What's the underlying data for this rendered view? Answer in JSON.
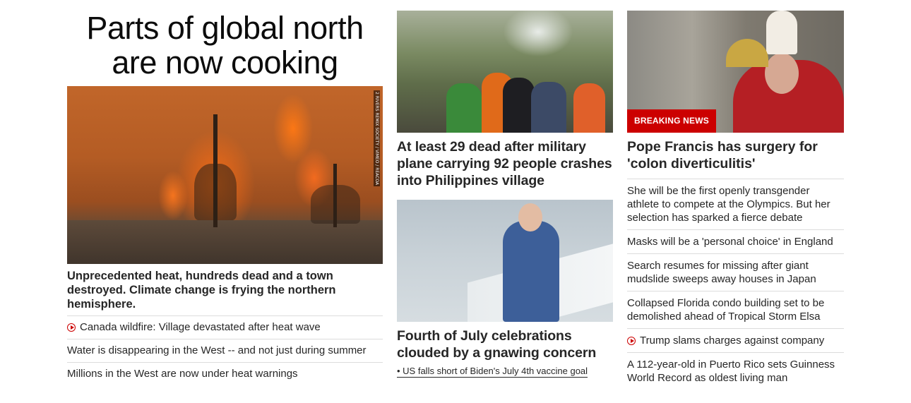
{
  "left": {
    "headline": "Parts of global north are now cooking",
    "image_credit": "2 RIVERS REMIX SOCIETY / VIMEO / REACOA",
    "lead": "Unprecedented heat, hundreds dead and a town destroyed. Climate change is frying the northern hemisphere.",
    "items": [
      {
        "text": "Canada wildfire: Village devastated after heat wave",
        "video": true
      },
      {
        "text": "Water is disappearing in the West -- and not just during summer",
        "video": false
      },
      {
        "text": "Millions in the West are now under heat warnings",
        "video": false
      }
    ]
  },
  "middle": {
    "story1_title": "At least 29 dead after military plane carrying 92 people crashes into Philippines village",
    "story2_title": "Fourth of July celebrations clouded by a gnawing concern",
    "story2_bullet": "• US falls short of Biden's July 4th vaccine goal"
  },
  "right": {
    "badge": "BREAKING NEWS",
    "title": "Pope Francis has surgery for 'colon diverticulitis'",
    "items": [
      {
        "text": "She will be the first openly transgender athlete to compete at the Olympics. But her selection has sparked a fierce debate",
        "video": false
      },
      {
        "text": "Masks will be a 'personal choice' in England",
        "video": false
      },
      {
        "text": "Search resumes for missing after giant mudslide sweeps away houses in Japan",
        "video": false
      },
      {
        "text": "Collapsed Florida condo building set to be demolished ahead of Tropical Storm Elsa",
        "video": false
      },
      {
        "text": "Trump slams charges against company",
        "video": true
      },
      {
        "text": "A 112-year-old in Puerto Rico sets Guinness World Record as oldest living man",
        "video": false
      }
    ]
  },
  "colors": {
    "accent": "#cc0000",
    "text": "#262626",
    "divider": "#dcdcdc"
  }
}
